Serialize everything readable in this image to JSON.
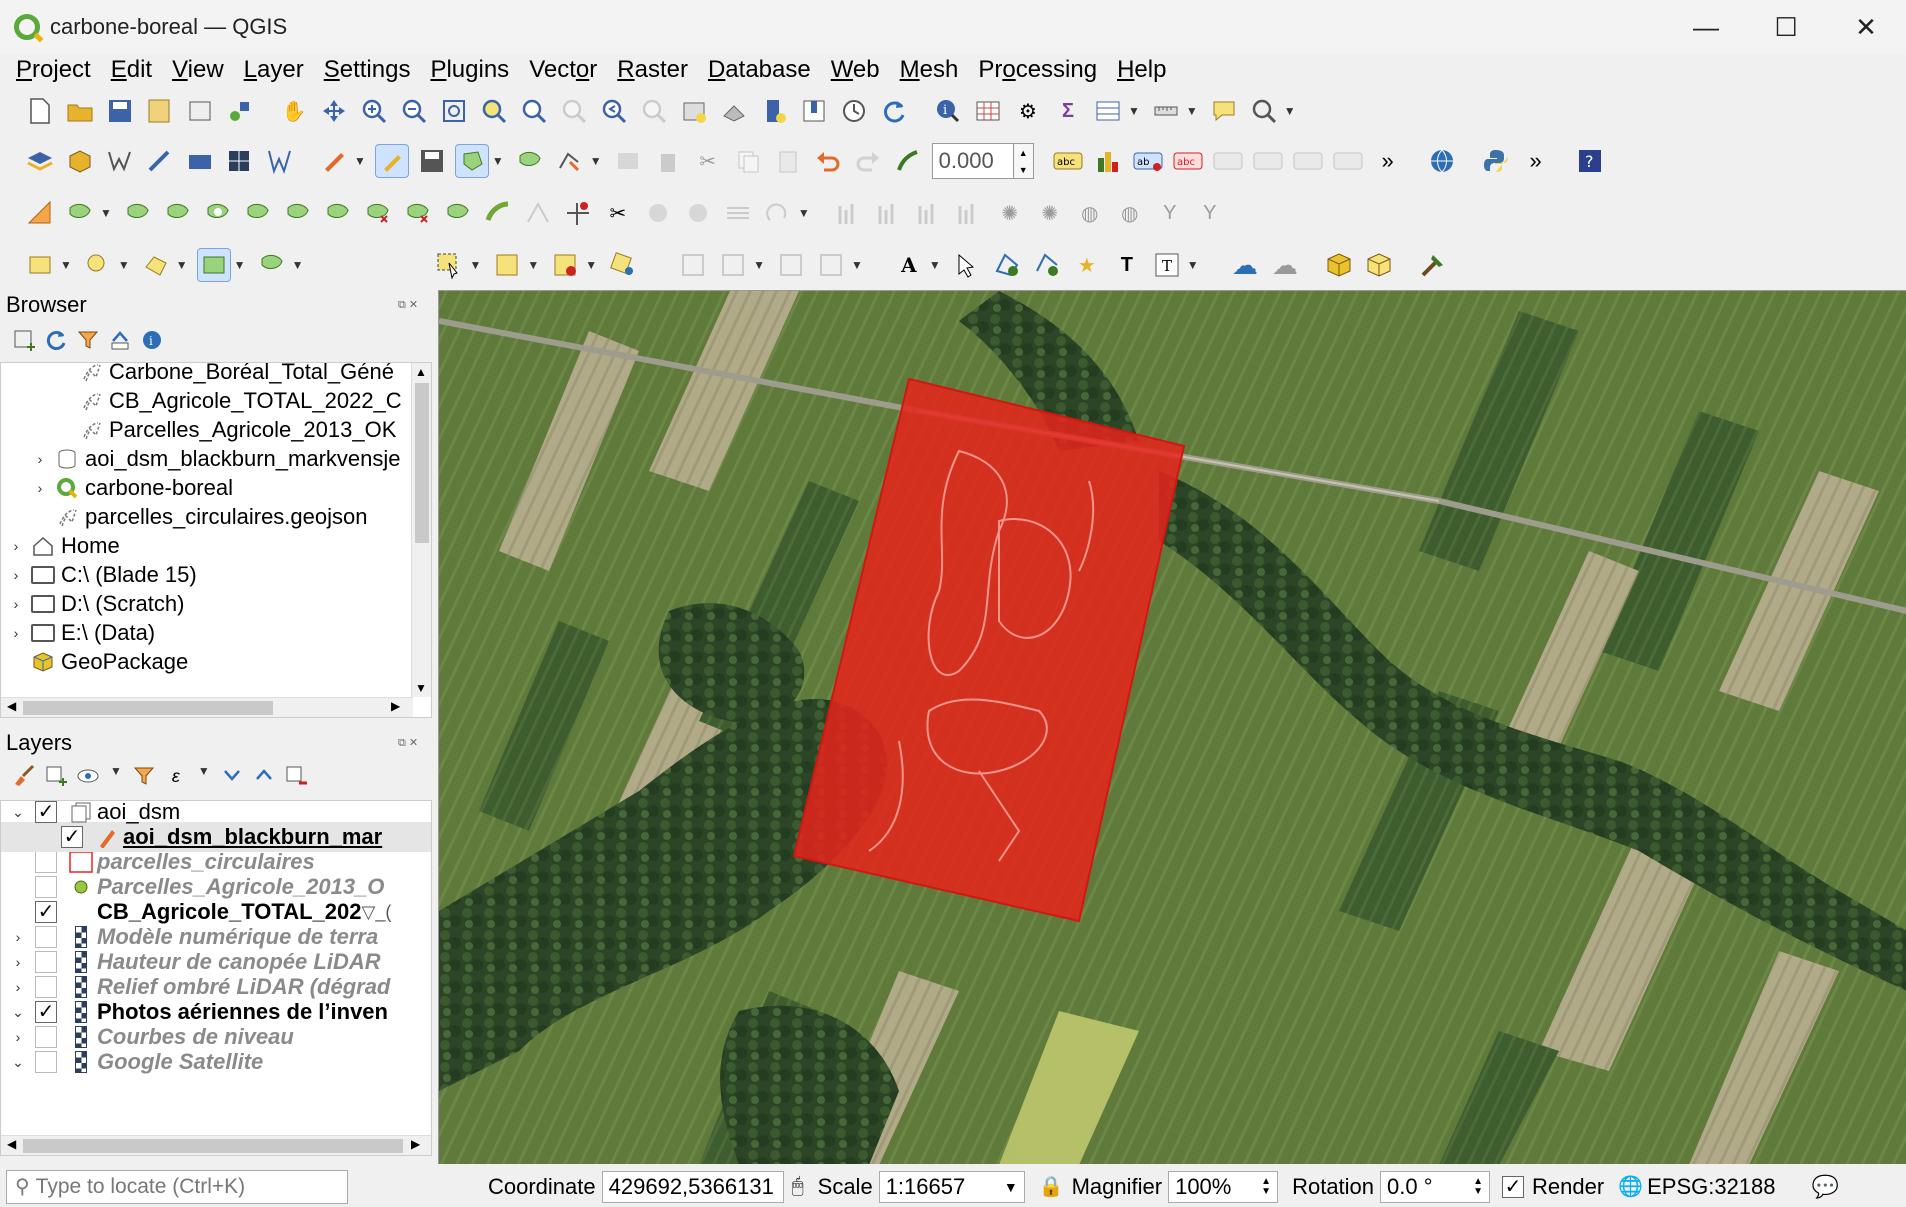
{
  "window": {
    "title": "carbone-boreal — QGIS",
    "minimize": "—",
    "maximize": "☐",
    "close": "✕"
  },
  "menu": [
    {
      "label": "Project",
      "u": "P",
      "rest": "roject"
    },
    {
      "label": "Edit",
      "u": "E",
      "rest": "dit"
    },
    {
      "label": "View",
      "u": "V",
      "rest": "iew"
    },
    {
      "label": "Layer",
      "u": "L",
      "rest": "ayer"
    },
    {
      "label": "Settings",
      "u": "S",
      "rest": "ettings"
    },
    {
      "label": "Plugins",
      "u": "P",
      "rest": "lugins"
    },
    {
      "label": "Vector",
      "u": "o",
      "pre": "Vect",
      "rest": "r"
    },
    {
      "label": "Raster",
      "u": "R",
      "rest": "aster"
    },
    {
      "label": "Database",
      "u": "D",
      "rest": "atabase"
    },
    {
      "label": "Web",
      "u": "W",
      "rest": "eb"
    },
    {
      "label": "Mesh",
      "u": "M",
      "rest": "esh"
    },
    {
      "label": "Processing",
      "u": "o",
      "pre": "Pr",
      "rest": "cessing"
    },
    {
      "label": "Help",
      "u": "H",
      "rest": "elp"
    }
  ],
  "toolbar": {
    "offset_value": "0.000"
  },
  "browser": {
    "title": "Browser",
    "dock_buttons": "⧉ ✕",
    "items": [
      {
        "label": "Carbone_Boréal_Total_Géné",
        "indent": 2,
        "arrow": "",
        "icon": "geojson"
      },
      {
        "label": "CB_Agricole_TOTAL_2022_C",
        "indent": 2,
        "arrow": "",
        "icon": "geojson"
      },
      {
        "label": "Parcelles_Agricole_2013_OK",
        "indent": 2,
        "arrow": "",
        "icon": "geojson"
      },
      {
        "label": "aoi_dsm_blackburn_markvensje",
        "indent": 1,
        "arrow": "›",
        "icon": "database"
      },
      {
        "label": "carbone-boreal",
        "indent": 1,
        "arrow": "›",
        "icon": "qgis"
      },
      {
        "label": "parcelles_circulaires.geojson",
        "indent": 1,
        "arrow": "",
        "icon": "geojson"
      },
      {
        "label": "Home",
        "indent": 0,
        "arrow": "›",
        "icon": "home"
      },
      {
        "label": "C:\\ (Blade 15)",
        "indent": 0,
        "arrow": "›",
        "icon": "folder"
      },
      {
        "label": "D:\\ (Scratch)",
        "indent": 0,
        "arrow": "›",
        "icon": "folder"
      },
      {
        "label": "E:\\ (Data)",
        "indent": 0,
        "arrow": "›",
        "icon": "folder"
      },
      {
        "label": "GeoPackage",
        "indent": 0,
        "arrow": "",
        "icon": "geopackage"
      }
    ]
  },
  "layers": {
    "title": "Layers",
    "dock_buttons": "⧉ ✕",
    "items": [
      {
        "label": "aoi_dsm",
        "indent": 0,
        "arrow": "⌄",
        "checked": true,
        "style": "normal",
        "icon": "group"
      },
      {
        "label": "aoi_dsm_blackburn_mar",
        "indent": 1,
        "arrow": "",
        "checked": true,
        "style": "bold-underline",
        "icon": "edit"
      },
      {
        "label": "parcelles_circulaires",
        "indent": 0,
        "arrow": "",
        "checked": false,
        "style": "italic-gray",
        "icon": "polygon-red"
      },
      {
        "label": "Parcelles_Agricole_2013_O",
        "indent": 0,
        "arrow": "",
        "checked": false,
        "style": "italic-gray",
        "icon": "point-green"
      },
      {
        "label": "CB_Agricole_TOTAL_202",
        "indent": 0,
        "arrow": "",
        "checked": true,
        "style": "bold",
        "icon": "none",
        "suffix": "▽_("
      },
      {
        "label": "Modèle numérique de terra",
        "indent": 0,
        "arrow": "›",
        "checked": false,
        "style": "italic-gray",
        "icon": "raster"
      },
      {
        "label": "Hauteur de canopée LiDAR",
        "indent": 0,
        "arrow": "›",
        "checked": false,
        "style": "italic-gray",
        "icon": "raster"
      },
      {
        "label": "Relief ombré LiDAR (dégrad",
        "indent": 0,
        "arrow": "›",
        "checked": false,
        "style": "italic-gray",
        "icon": "raster"
      },
      {
        "label": "Photos aériennes de l’inven",
        "indent": 0,
        "arrow": "⌄",
        "checked": true,
        "style": "bold",
        "icon": "raster"
      },
      {
        "label": "Courbes de niveau",
        "indent": 0,
        "arrow": "›",
        "checked": false,
        "style": "italic-gray",
        "icon": "raster"
      },
      {
        "label": "Google Satellite",
        "indent": 0,
        "arrow": "⌄",
        "checked": false,
        "style": "italic-gray",
        "icon": "raster"
      }
    ]
  },
  "status": {
    "locator_placeholder": "Type to locate (Ctrl+K)",
    "coordinate_label": "Coordinate",
    "coordinate_value": "429692,5366131",
    "scale_label": "Scale",
    "scale_value": "1:16657",
    "magnifier_label": "Magnifier",
    "magnifier_value": "100%",
    "rotation_label": "Rotation",
    "rotation_value": "0.0 °",
    "render_label": "Render",
    "crs_label": "EPSG:32188"
  },
  "colors": {
    "aoi_fill": "#e8231c",
    "accent": "#2d6db5"
  }
}
